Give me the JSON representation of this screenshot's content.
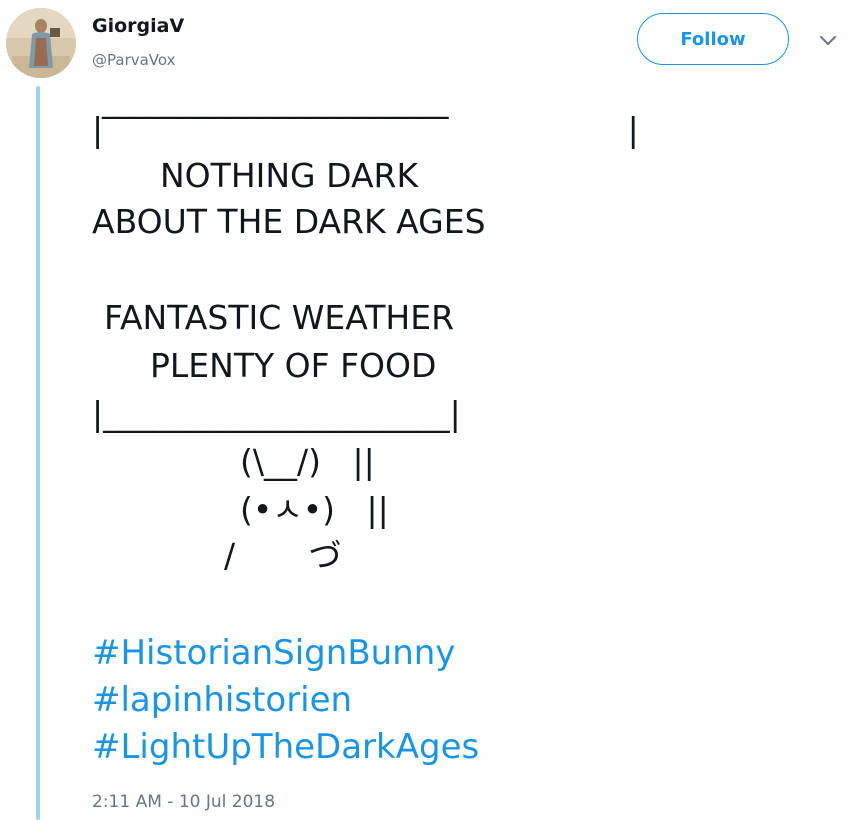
{
  "user": {
    "display_name": "GiorgiaV",
    "handle": "@ParvaVox"
  },
  "actions": {
    "follow_label": "Follow"
  },
  "tweet": {
    "ascii_lines": [
      "_____________________",
      "|                                                  |",
      "NOTHING DARK",
      "ABOUT THE DARK AGES",
      "FANTASTIC WEATHER",
      "PLENTY OF FOOD",
      "|_____________________|",
      "(\\__/)   ||",
      "(•ㅅ•)   ||",
      "/       づ"
    ],
    "hashtags": [
      "#HistorianSignBunny",
      "#lapinhistorien",
      "#LightUpTheDarkAges"
    ],
    "timestamp": "2:11 AM - 10 Jul 2018"
  },
  "colors": {
    "accent": "#1b95e0",
    "thread_line": "#9fd3e8",
    "secondary_text": "#657786",
    "primary_text": "#14171a"
  },
  "icons": {
    "avatar": "avatar-image",
    "menu": "chevron-down-icon"
  }
}
